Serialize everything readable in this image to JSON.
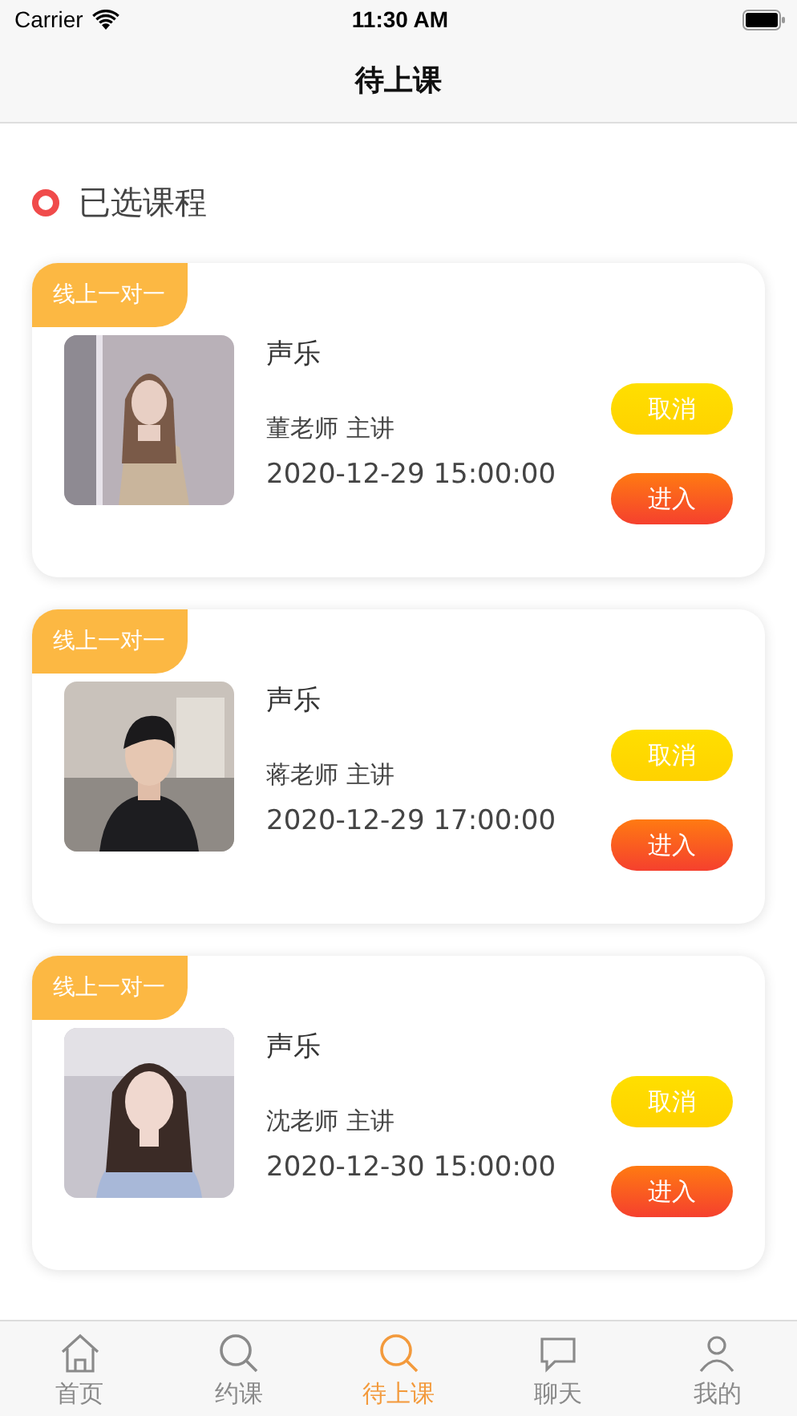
{
  "status_bar": {
    "carrier": "Carrier",
    "time": "11:30 AM"
  },
  "nav": {
    "title": "待上课"
  },
  "section": {
    "title": "已选课程"
  },
  "courses": [
    {
      "tag": "线上一对一",
      "title": "声乐",
      "teacher": "董老师 主讲",
      "time": "2020-12-29 15:00:00",
      "photo": {
        "kind": "picture"
      },
      "buttons": [
        {
          "kind": "cancel",
          "label": "取消"
        },
        {
          "kind": "enter",
          "label": "进入"
        }
      ]
    },
    {
      "tag": "线上一对一",
      "title": "声乐",
      "teacher": "蒋老师 主讲",
      "time": "2020-12-29 17:00:00",
      "photo": {
        "kind": "picture"
      },
      "buttons": [
        {
          "kind": "cancel",
          "label": "取消"
        },
        {
          "kind": "enter",
          "label": "进入"
        }
      ]
    },
    {
      "tag": "线上一对一",
      "title": "声乐",
      "teacher": "沈老师 主讲",
      "time": "2020-12-30 15:00:00",
      "photo": {
        "kind": "picture"
      },
      "buttons": [
        {
          "kind": "cancel",
          "label": "取消"
        },
        {
          "kind": "enter",
          "label": "进入"
        }
      ]
    }
  ],
  "tab_bar": [
    {
      "kind": "home",
      "label": "首页",
      "selected": false
    },
    {
      "kind": "search",
      "label": "约课",
      "selected": false
    },
    {
      "kind": "search",
      "label": "待上课",
      "selected": true
    },
    {
      "kind": "chat",
      "label": "聊天",
      "selected": false
    },
    {
      "kind": "person",
      "label": "我的",
      "selected": false
    }
  ]
}
